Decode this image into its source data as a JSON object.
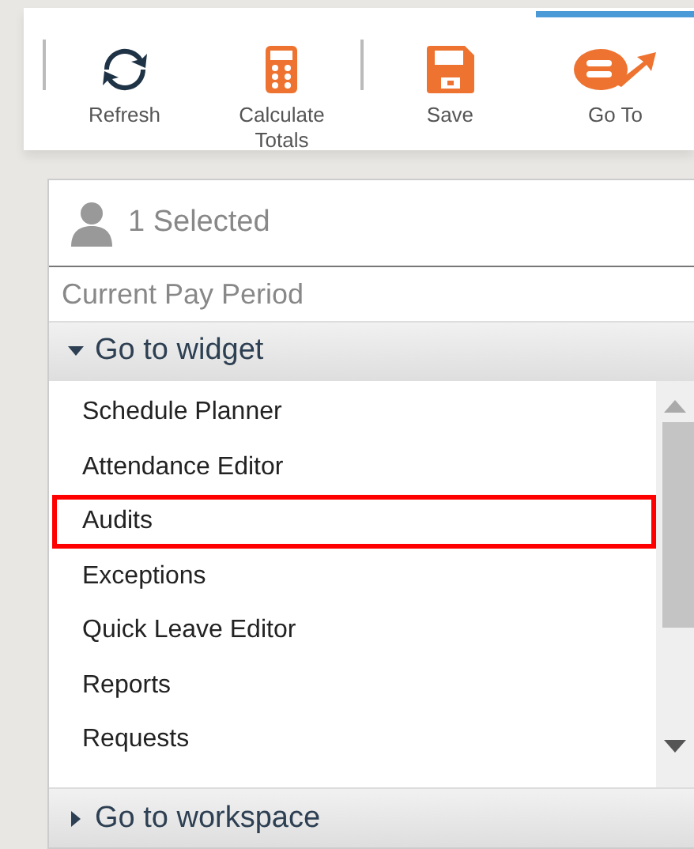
{
  "toolbar": {
    "buttons": [
      {
        "kind": "refresh",
        "label": "Refresh",
        "active": false
      },
      {
        "kind": "calculator",
        "label": "Calculate Totals",
        "active": false
      },
      {
        "kind": "save",
        "label": "Save",
        "active": false
      },
      {
        "kind": "goto",
        "label": "Go To",
        "active": true
      }
    ]
  },
  "menu": {
    "selection": "1 Selected",
    "period": "Current Pay Period",
    "sections": [
      {
        "label": "Go to widget",
        "expanded": true,
        "items": [
          {
            "label": "Schedule Planner",
            "highlighted": false
          },
          {
            "label": "Attendance Editor",
            "highlighted": false
          },
          {
            "label": "Audits",
            "highlighted": true
          },
          {
            "label": "Exceptions",
            "highlighted": false
          },
          {
            "label": "Quick Leave Editor",
            "highlighted": false
          },
          {
            "label": "Reports",
            "highlighted": false
          },
          {
            "label": "Requests",
            "highlighted": false
          }
        ]
      },
      {
        "label": "Go to workspace",
        "expanded": false
      }
    ]
  }
}
